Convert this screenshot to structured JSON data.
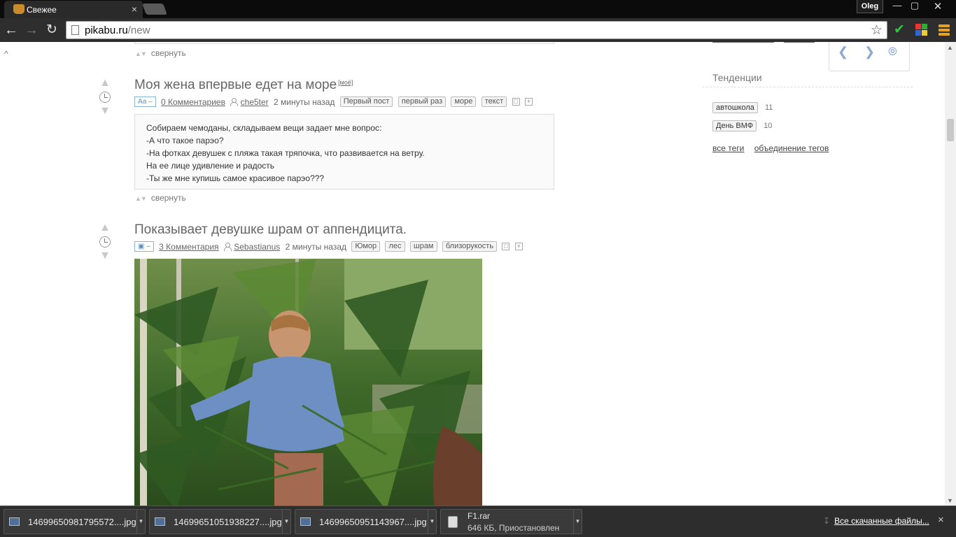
{
  "browser": {
    "tab_title": "Свежее",
    "tab_close": "×",
    "user": "Oleg",
    "win_min": "—",
    "win_max": "▢",
    "win_close": "✕",
    "url_host": "pikabu.ru",
    "url_path": "/new"
  },
  "feed": {
    "collapse_label": "свернуть",
    "posts": [
      {
        "title": "Моя жена впервые едет на море",
        "mine_label": "[моё]",
        "type_label": "Аа –",
        "comments": "0 Комментариев",
        "author": "che5ter",
        "time": "2 минуты назад",
        "tags": [
          "Первый пост",
          "первый раз",
          "море",
          "текст"
        ],
        "body": [
          "Собираем чемоданы, складываем вещи задает мне вопрос:",
          "-А что такое парэо?",
          "-На фотках девушек с пляжа такая тряпочка, что развивается на ветру.",
          "На ее лице удивление и радость",
          "-Ты же мне купишь самое красивое парэо???"
        ]
      },
      {
        "title": "Показывает девушке шрам от аппендицита.",
        "type_label": "–",
        "comments": "3 Комментария",
        "author": "Sebastianus",
        "time": "2 минуты назад",
        "tags": [
          "Юмор",
          "лес",
          "шрам",
          "близорукость"
        ]
      }
    ]
  },
  "sidebar": {
    "trends_title": "Тенденции",
    "trends": [
      {
        "tag": "автошкола",
        "count": "11"
      },
      {
        "tag": "День ВМФ",
        "count": "10"
      }
    ],
    "all_tags": "все теги",
    "merge_tags": "объединение тегов"
  },
  "downloads": {
    "items": [
      {
        "name": "14699650981795572....jpg"
      },
      {
        "name": "14699651051938227....jpg"
      },
      {
        "name": "14699650951143967....jpg"
      }
    ],
    "rar": {
      "name": "F1.rar",
      "status": "646 КБ, Приостановлен"
    },
    "all_label": "Все скачанные файлы...",
    "close": "×"
  },
  "colors": {
    "chrome_dark": "#0b0b0b",
    "toolbar": "#2e2e2e",
    "accent_blue": "#5b8fbd"
  }
}
